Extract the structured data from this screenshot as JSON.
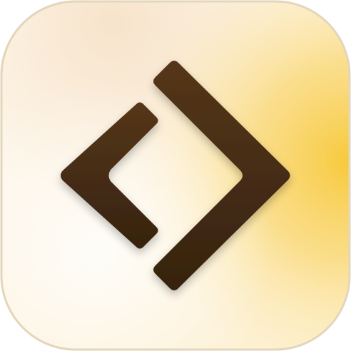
{
  "icon": {
    "name": "code-brackets-icon",
    "description_colors": {
      "tile_light": "#fffaf0",
      "tile_peach": "#f6e0c6",
      "tile_cream": "#fdf0cf",
      "tile_gold": "#f7c93a",
      "tile_border": "#e3d6bd",
      "glyph_top": "#55361a",
      "glyph_bottom": "#36230f"
    }
  }
}
